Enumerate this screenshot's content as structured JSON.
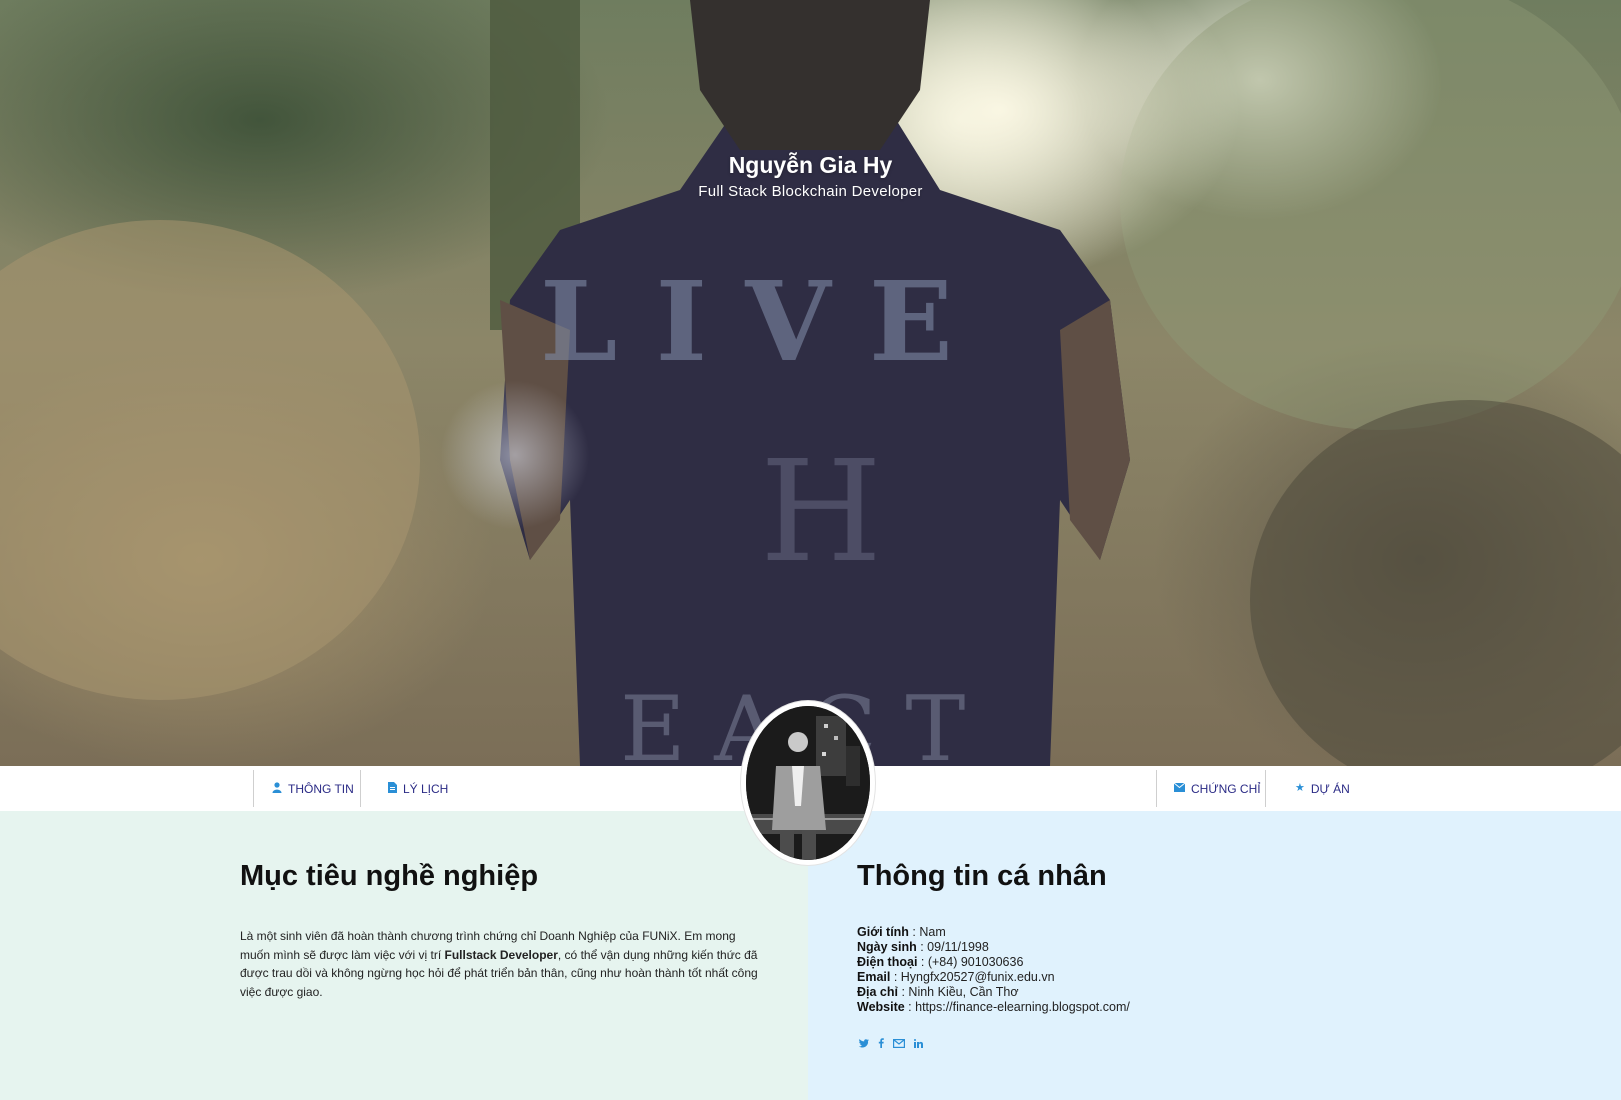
{
  "hero": {
    "name": "Nguyễn Gia Hy",
    "role": "Full Stack Blockchain Developer"
  },
  "nav": {
    "items": [
      {
        "label": "THÔNG TIN",
        "icon": "user-icon"
      },
      {
        "label": "LÝ LỊCH",
        "icon": "document-icon"
      },
      {
        "label": "CHỨNG CHỈ",
        "icon": "envelope-icon"
      },
      {
        "label": "DỰ ÁN",
        "icon": "star-icon"
      }
    ]
  },
  "avatar": {
    "alt": "profile-photo"
  },
  "objective": {
    "title": "Mục tiêu nghề nghiệp",
    "text_before": "Là một sinh viên đã hoàn thành chương trình chứng chỉ Doanh Nghiệp của FUNiX. Em mong muốn mình sẽ được làm việc với vị trí ",
    "text_bold": "Fullstack Developer",
    "text_after": ", có thể vận dụng những kiến thức đã được trau dồi và không ngừng học hỏi để phát triển bản thân, cũng như hoàn thành tốt nhất công việc được giao."
  },
  "personal": {
    "title": "Thông tin cá nhân",
    "rows": [
      {
        "label": "Giới tính",
        "value": "Nam"
      },
      {
        "label": "Ngày sinh",
        "value": "09/11/1998"
      },
      {
        "label": "Điện thoại",
        "value": "(+84) 901030636"
      },
      {
        "label": "Email",
        "value": "Hyngfx20527@funix.edu.vn"
      },
      {
        "label": "Địa chỉ",
        "value": "Ninh Kiều, Cần Thơ"
      },
      {
        "label": "Website",
        "value": "https://finance-elearning.blogspot.com/"
      }
    ],
    "separator": " : "
  },
  "socials": [
    "twitter-icon",
    "facebook-icon",
    "mail-icon",
    "linkedin-icon"
  ],
  "colors": {
    "nav_text": "#2b2b86",
    "icon_blue": "#2a8fd6",
    "panel_left": "#e6f4ef",
    "panel_right": "#e0f2fd"
  }
}
